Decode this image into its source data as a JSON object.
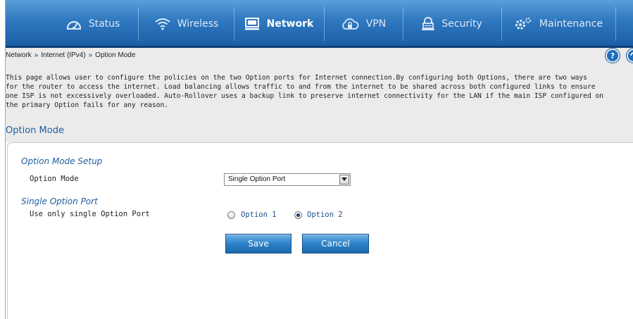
{
  "nav": {
    "items": [
      {
        "label": "Status",
        "icon": "gauge-icon",
        "active": false
      },
      {
        "label": "Wireless",
        "icon": "wifi-icon",
        "active": false
      },
      {
        "label": "Network",
        "icon": "monitor-icon",
        "active": true
      },
      {
        "label": "VPN",
        "icon": "cloud-lock-icon",
        "active": false
      },
      {
        "label": "Security",
        "icon": "lock-icon",
        "active": false
      },
      {
        "label": "Maintenance",
        "icon": "gears-icon",
        "active": false
      }
    ]
  },
  "breadcrumb": {
    "items": [
      "Network",
      "Internet (IPv4)",
      "Option Mode"
    ],
    "separator": "»"
  },
  "description": {
    "lines": [
      "This page allows user to configure the policies on the two Option ports for Internet connection.By configuring both Options, there are two ways",
      "for the router to access the internet. Load balancing allows traffic to and from the internet to be shared across both configured links to ensure",
      "one ISP is not excessively overloaded. Auto-Rollover uses a backup link to preserve internet connectivity for the LAN if the main ISP configured on",
      "the primary Option fails for any reason."
    ]
  },
  "section_title": "Option Mode",
  "form": {
    "setup_heading": "Option Mode Setup",
    "mode_label": "Option Mode",
    "mode_value": "Single Option Port",
    "single_heading": "Single Option Port",
    "single_label": "Use only single Option Port",
    "radio_option1": "Option 1",
    "radio_option2": "Option 2",
    "selected_option": "Option 2",
    "save_label": "Save",
    "cancel_label": "Cancel"
  },
  "colors": {
    "nav_blue": "#2f78bf",
    "heading_blue": "#1d5f9e",
    "page_gray": "#ebebeb"
  }
}
